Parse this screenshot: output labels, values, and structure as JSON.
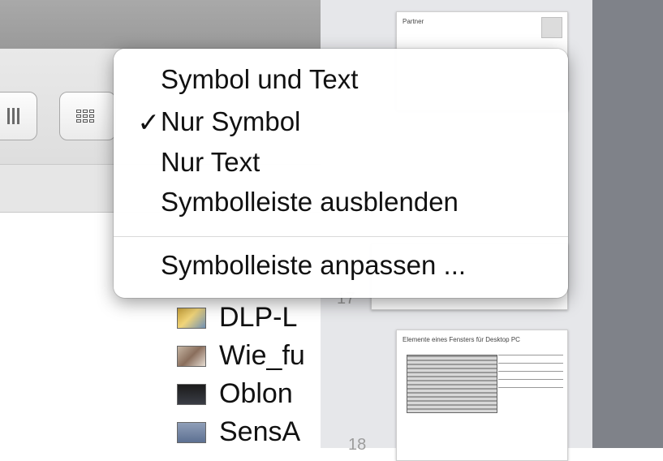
{
  "window": {
    "file_list": [
      {
        "name": "DLP-L",
        "thumb": "document-thumbnail"
      },
      {
        "name": "Wie_fu",
        "thumb": "photo-thumbnail"
      },
      {
        "name": "Oblon",
        "thumb": "video-thumbnail"
      },
      {
        "name": "SensA",
        "thumb": "document-thumbnail"
      }
    ]
  },
  "pages": {
    "prev_page_number": "17",
    "next_page_number": "18",
    "top_page_title": "Partner",
    "page_18_title": "Elemente eines Fensters für Desktop PC"
  },
  "context_menu": {
    "checkmark": "✓",
    "items": [
      {
        "label": "Symbol und Text",
        "checked": false
      },
      {
        "label": "Nur Symbol",
        "checked": true
      },
      {
        "label": "Nur Text",
        "checked": false
      },
      {
        "label": "Symbolleiste ausblenden",
        "checked": false
      },
      {
        "label": "Symbolleiste anpassen ...",
        "checked": false
      }
    ]
  },
  "colors": {
    "titlebar": "#9f9f9f",
    "toolbar": "#e4e4e4",
    "page_strip": "#e6e7ea",
    "right_edge": "#7f8289",
    "menu_background": "#ffffff"
  }
}
